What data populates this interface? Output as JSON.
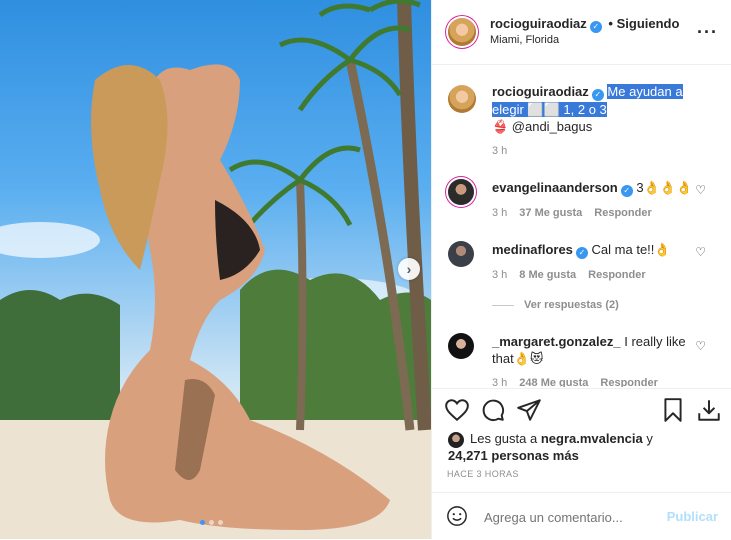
{
  "post": {
    "image_alt": "",
    "carousel_dots": 3,
    "carousel_active_index": 0
  },
  "header": {
    "username": "rocioguiraodiaz",
    "separator": "•",
    "follow_label": "Siguiendo",
    "location": "Miami, Florida"
  },
  "caption": {
    "username": "rocioguiraodiaz",
    "text_highlighted": "Me ayudan a elegir ⬜⬜ 1, 2 o 3",
    "text_rest": "👙 @andi_bagus",
    "time": "3 h"
  },
  "comments": [
    {
      "username": "evangelinaanderson",
      "verified": true,
      "text": "3👌👌👌",
      "time": "3 h",
      "likes": "37 Me gusta",
      "reply": "Responder"
    },
    {
      "username": "medinaflores",
      "verified": true,
      "text": "Cal ma te!!👌",
      "time": "3 h",
      "likes": "8 Me gusta",
      "reply": "Responder"
    },
    {
      "username": "_margaret.gonzalez_",
      "verified": false,
      "text": "I really like that👌😻",
      "time": "3 h",
      "likes": "248 Me gusta",
      "reply": "Responder"
    }
  ],
  "view_replies": "Ver respuestas (2)",
  "likes": {
    "prefix": "Les gusta a ",
    "user": "negra.mvalencia",
    "connector": " y",
    "count_text": "24,271 personas más"
  },
  "timestamp": "HACE 3 HORAS",
  "add_comment": {
    "placeholder": "Agrega un comentario...",
    "publish_label": "Publicar"
  },
  "colors": {
    "verified": "#3897f0",
    "highlight": "#3879d9",
    "publish_disabled": "#b2dffc"
  },
  "icons": [
    "heart-icon",
    "comment-icon",
    "share-icon",
    "bookmark-icon",
    "download-icon",
    "emoji-icon",
    "more-options-icon",
    "chevron-right-icon",
    "verified-icon"
  ]
}
